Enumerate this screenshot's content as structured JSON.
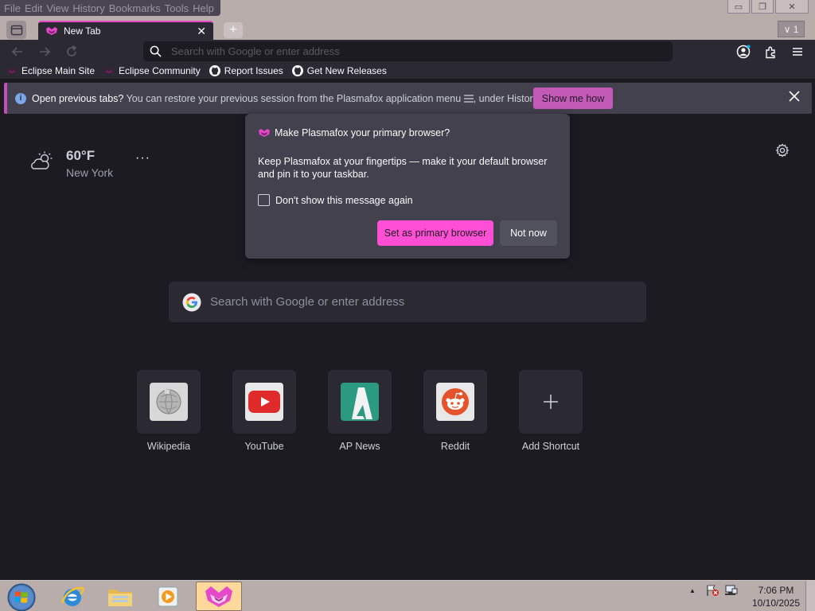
{
  "menu": {
    "items": [
      "File",
      "Edit",
      "View",
      "History",
      "Bookmarks",
      "Tools",
      "Help"
    ]
  },
  "window_controls": {
    "minimize": "▭",
    "restore": "❐",
    "close": "✕"
  },
  "tabs": {
    "active": {
      "title": "New Tab",
      "close_glyph": "✕"
    },
    "new_tab_glyph": "+",
    "tab_count": "∨ 1"
  },
  "navbar": {
    "url_placeholder": "Search with Google or enter address"
  },
  "bookmarks": [
    {
      "label": "Eclipse Main Site",
      "icon": "plasmafox-icon"
    },
    {
      "label": "Eclipse Community",
      "icon": "plasmafox-icon"
    },
    {
      "label": "Report Issues",
      "icon": "github-icon"
    },
    {
      "label": "Get New Releases",
      "icon": "github-icon"
    }
  ],
  "notification": {
    "title": "Open previous tabs?",
    "message_pre": " You can restore your previous session from the Plasmafox application menu ",
    "message_post": ", under History.",
    "action_label": "Show me how"
  },
  "weather": {
    "temp": "60°F",
    "city": "New York",
    "more": "···"
  },
  "popup": {
    "title": "Make Plasmafox your primary browser?",
    "body": "Keep Plasmafox at your fingertips — make it your default browser and pin it to your taskbar.",
    "checkbox_label": "Don't show this message again",
    "primary_label": "Set as primary browser",
    "secondary_label": "Not now"
  },
  "main_search": {
    "placeholder": "Search with Google or enter address"
  },
  "shortcuts": [
    {
      "label": "Wikipedia",
      "icon": "wikipedia-icon"
    },
    {
      "label": "YouTube",
      "icon": "youtube-icon"
    },
    {
      "label": "AP News",
      "icon": "apnews-icon"
    },
    {
      "label": "Reddit",
      "icon": "reddit-icon"
    },
    {
      "label": "Add Shortcut",
      "icon": "plus-icon"
    }
  ],
  "taskbar": {
    "time": "7:06 PM",
    "date": "10/10/2025",
    "tray_arrow": "▲"
  },
  "colors": {
    "accent": "#ff4fd5",
    "notification_accent": "#c45ab8",
    "background": "#1c1b22",
    "toolbar": "#2b2a33"
  }
}
